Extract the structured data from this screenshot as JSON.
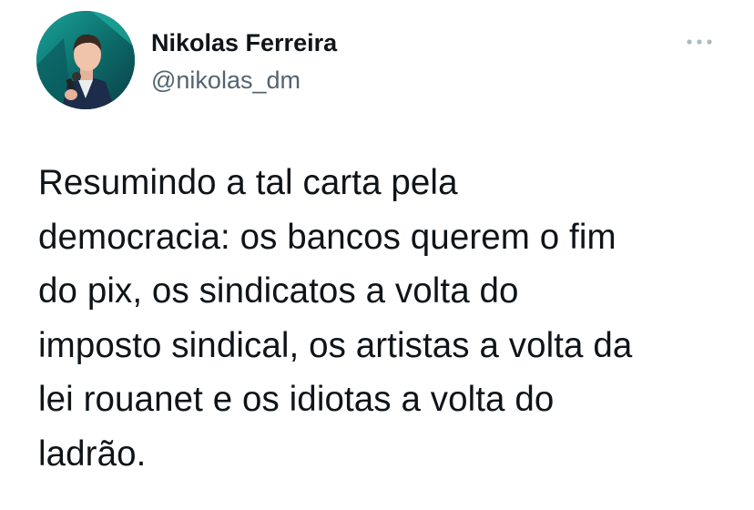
{
  "tweet": {
    "author": {
      "display_name": "Nikolas Ferreira",
      "handle": "@nikolas_dm",
      "avatar_icon": "profile-photo"
    },
    "more_icon": "ellipsis-icon",
    "text_lines": [
      "Resumindo a tal carta pela",
      "democracia: os bancos querem o fim",
      "do pix, os sindicatos a volta do",
      "imposto sindical, os artistas a volta da",
      "lei rouanet e os idiotas a volta do",
      "ladrão."
    ]
  },
  "colors": {
    "text_primary": "#0f1419",
    "text_secondary": "#536471",
    "icon_gray": "#aab8c2",
    "avatar_bg": "#0d6b6a"
  }
}
